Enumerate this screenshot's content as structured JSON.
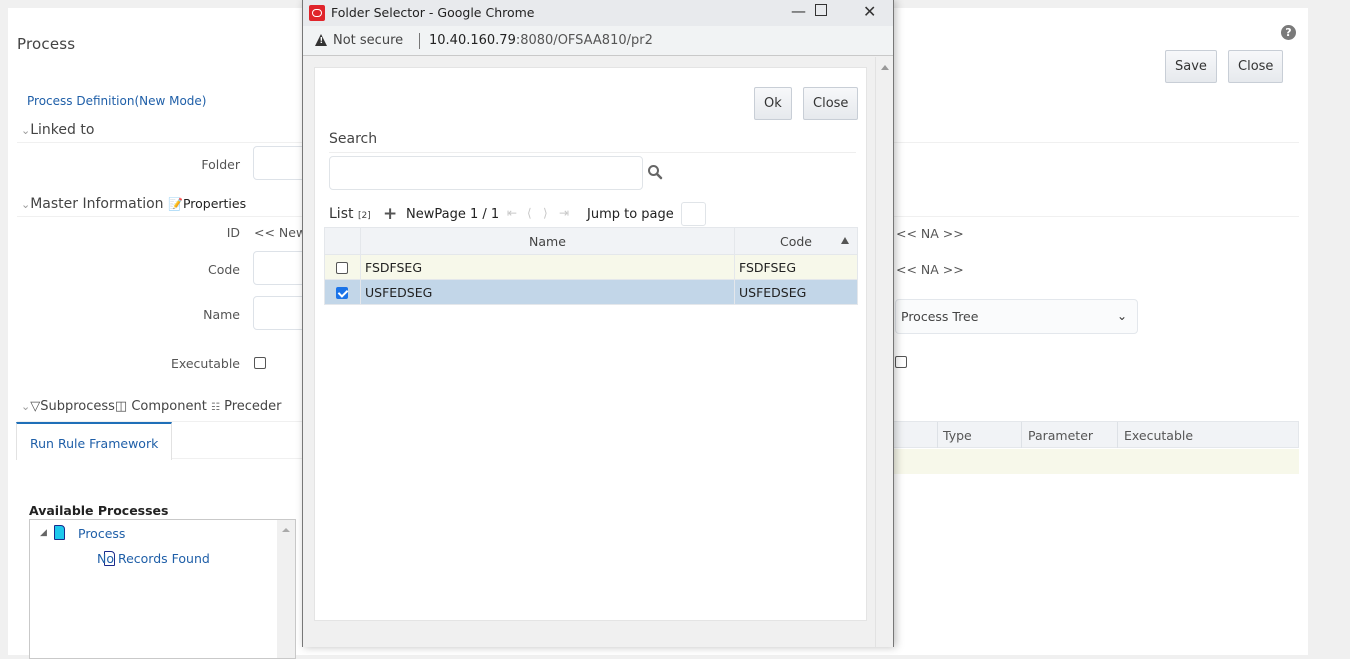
{
  "page": {
    "title": "Process",
    "save_label": "Save",
    "close_label": "Close",
    "mode_link": "Process Definition(New Mode)",
    "linked_to": {
      "header": "Linked to",
      "folder_label": "Folder",
      "folder_value": ""
    },
    "master_info": {
      "header": "Master Information",
      "properties_label": "Properties",
      "id_label": "ID",
      "id_value": "<< New",
      "code_label": "Code",
      "code_value": "",
      "name_label": "Name",
      "name_value": "",
      "executable_label": "Executable",
      "executable_checked": false,
      "na_value_1": "<< NA >>",
      "na_value_2": "<< NA >>",
      "tree_select_value": "Process Tree",
      "right_checkbox_checked": false
    },
    "subprocess_bar": {
      "subprocess_label": "Subprocess",
      "component_label": "Component",
      "precedence_label": "Preceder"
    },
    "tabs": [
      {
        "label": "Run Rule Framework",
        "active": true
      }
    ],
    "grid": {
      "columns": [
        "Type",
        "Parameter",
        "Executable"
      ],
      "rows": []
    },
    "available_processes": {
      "title": "Available Processes",
      "tree": [
        {
          "label": "Process",
          "expanded": true,
          "children": [
            {
              "label": "No Records Found"
            }
          ]
        }
      ]
    }
  },
  "popup": {
    "window_title": "Folder Selector - Google Chrome",
    "security_label": "Not secure",
    "url_host": "10.40.160.79",
    "url_rest": ":8080/OFSAA810/pr2",
    "ok_label": "Ok",
    "close_label": "Close",
    "search_label": "Search",
    "search_value": "",
    "list_label": "List",
    "list_count": "[2]",
    "new_label": "New",
    "page_info": "Page 1 / 1",
    "jump_label": "Jump to page",
    "jump_value": "",
    "table": {
      "columns": [
        "Name",
        "Code"
      ],
      "sort": {
        "column": "Code",
        "direction": "asc"
      },
      "rows": [
        {
          "name": "FSDFSEG",
          "code": "FSDFSEG",
          "checked": false
        },
        {
          "name": "USFEDSEG",
          "code": "USFEDSEG",
          "checked": true
        }
      ]
    }
  },
  "colors": {
    "link": "#1f5fa8",
    "selected_row": "#c2d6e8",
    "alt_row": "#f7f8ea",
    "tab_accent": "#1f6fb8",
    "oracle_red": "#e0242b"
  }
}
